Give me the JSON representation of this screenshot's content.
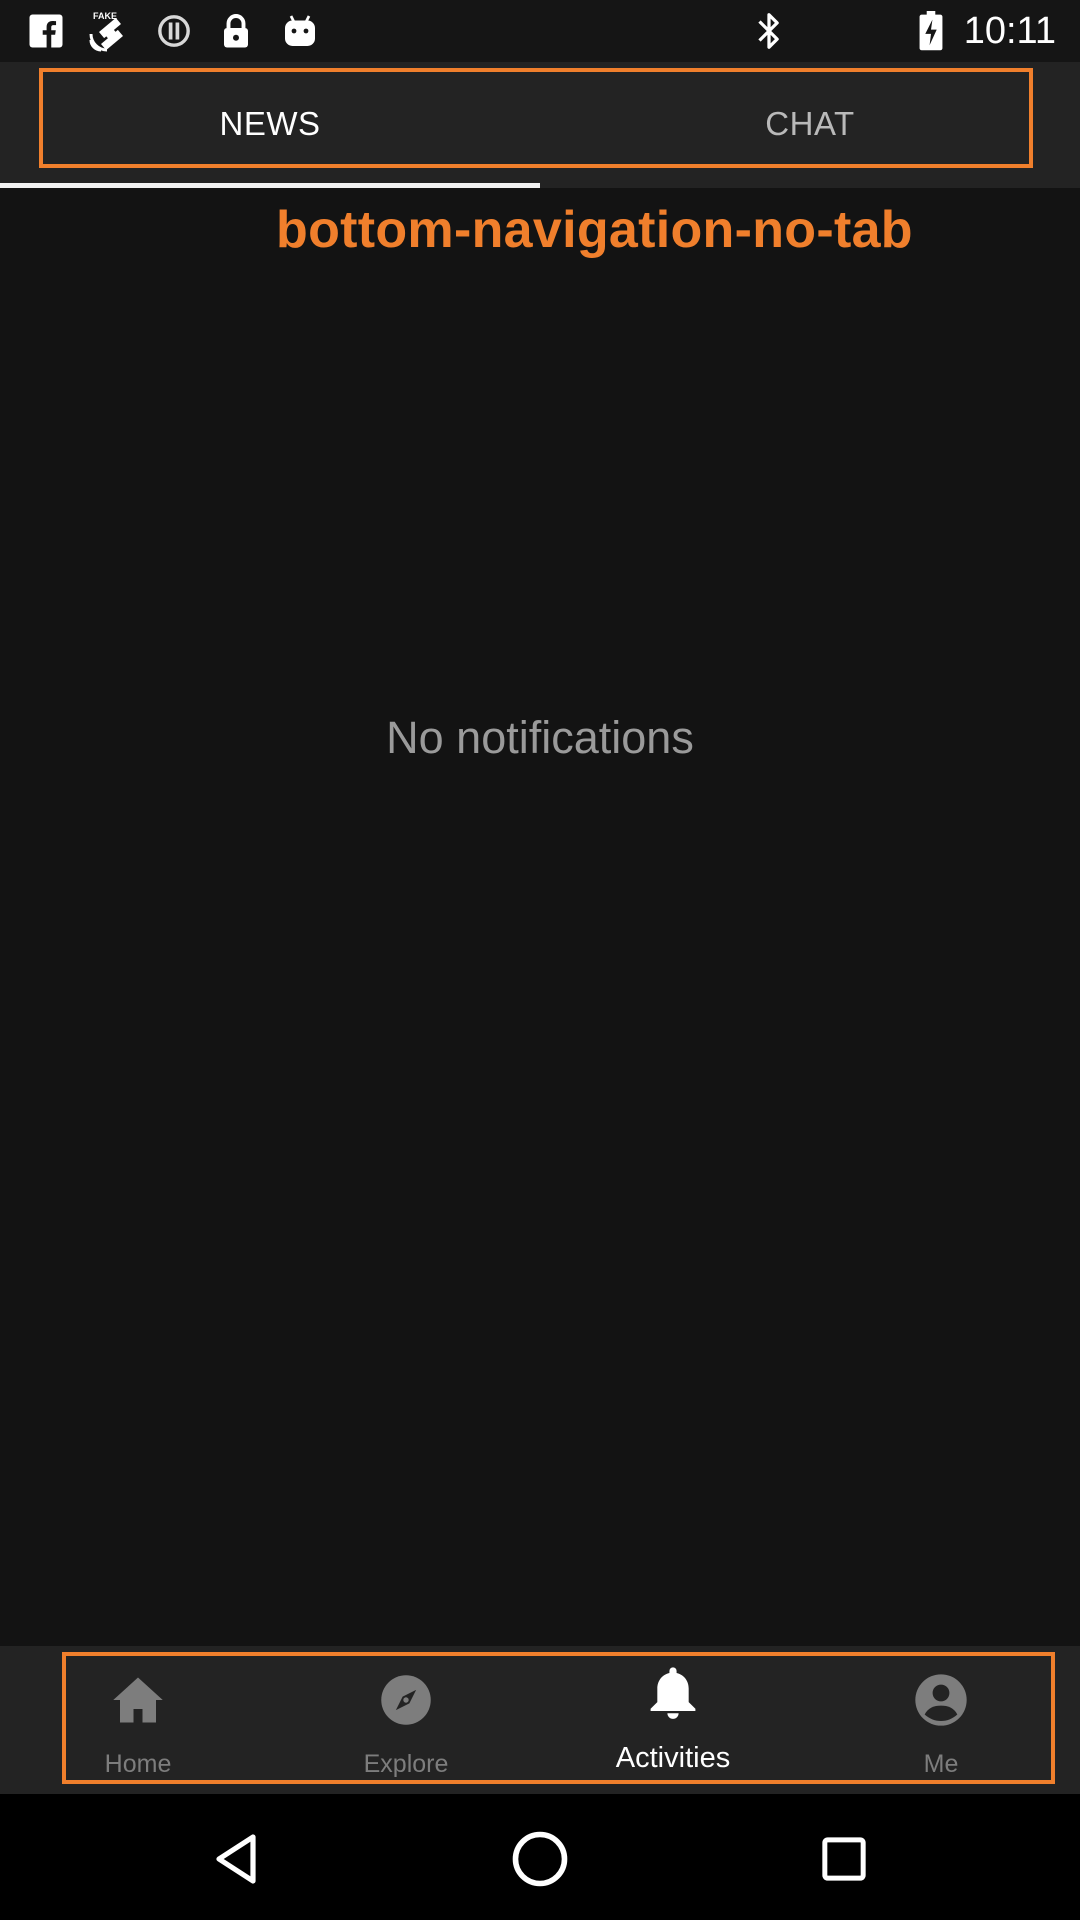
{
  "status_bar": {
    "time": "10:11",
    "icons": [
      "facebook-icon",
      "fake-gps-satellite-icon",
      "info-circle-icon",
      "lock-icon",
      "android-icon",
      "bluetooth-icon",
      "battery-charging-icon"
    ]
  },
  "tabs": [
    {
      "label": "NEWS",
      "selected": true
    },
    {
      "label": "CHAT",
      "selected": false
    }
  ],
  "annotation": "bottom-navigation-no-tab",
  "empty_state": "No notifications",
  "bottom_nav": [
    {
      "label": "Home",
      "icon": "home-icon",
      "selected": false
    },
    {
      "label": "Explore",
      "icon": "compass-icon",
      "selected": false
    },
    {
      "label": "Activities",
      "icon": "bell-icon",
      "selected": true
    },
    {
      "label": "Me",
      "icon": "account-circle-icon",
      "selected": false
    }
  ],
  "colors": {
    "background": "#131313",
    "bar": "#232323",
    "highlight": "#f07f2c",
    "active": "#ffffff",
    "inactive": "#7d7d7d"
  },
  "system_nav": [
    "back-icon",
    "home-circle-icon",
    "recents-icon"
  ]
}
